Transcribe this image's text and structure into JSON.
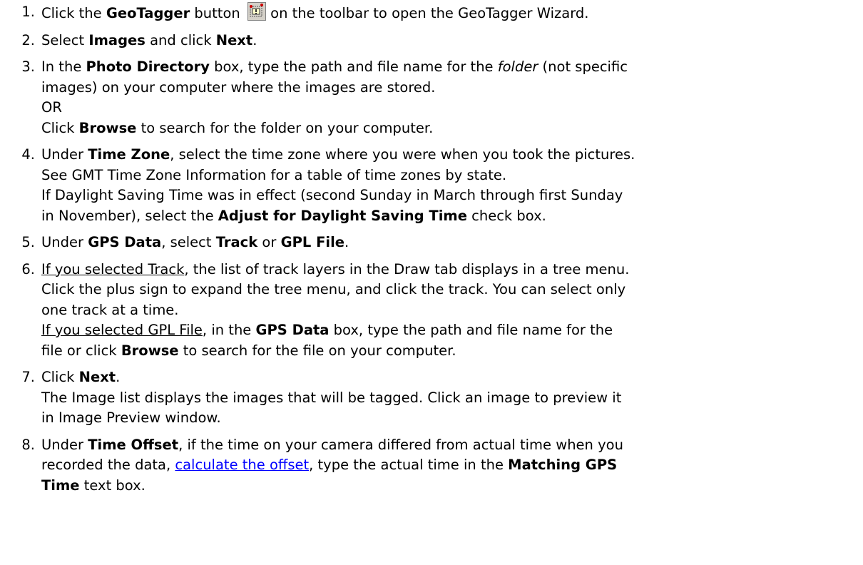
{
  "steps": [
    {
      "num": "1.",
      "parts": [
        "Click the ",
        "GeoTagger",
        " button ",
        " on the toolbar to open the GeoTagger Wizard."
      ],
      "icon": "geotagger-icon"
    },
    {
      "num": "2.",
      "parts": [
        "Select ",
        "Images",
        " and click ",
        "Next",
        "."
      ]
    },
    {
      "num": "3.",
      "lines": [
        [
          "In the ",
          "Photo Directory",
          " box, type the path and file name for the ",
          "folder",
          " (not specific"
        ],
        [
          "images) on your computer where the images are stored."
        ],
        [
          "OR"
        ],
        [
          "Click ",
          "Browse",
          " to search for the folder on your computer."
        ]
      ]
    },
    {
      "num": "4.",
      "lines": [
        [
          "Under ",
          "Time Zone",
          ", select the time zone where you were when you took the pictures."
        ],
        [
          "See GMT Time Zone Information for a table of time zones by state."
        ],
        [
          "If Daylight Saving Time was in effect (second Sunday in March through first Sunday"
        ],
        [
          "in November), select the ",
          "Adjust for Daylight Saving Time",
          " check box."
        ]
      ]
    },
    {
      "num": "5.",
      "parts": [
        "Under ",
        "GPS Data",
        ", select ",
        "Track",
        " or ",
        "GPL File",
        "."
      ]
    },
    {
      "num": "6.",
      "lines": [
        [
          "If you selected Track",
          ", the list of track layers in the Draw tab displays in a tree menu."
        ],
        [
          "Click the plus sign to expand the tree menu, and click the track. You can select only"
        ],
        [
          "one track at a time."
        ],
        [
          "If you selected GPL File",
          ", in the ",
          "GPS Data",
          " box, type the path and file name for the"
        ],
        [
          "file or click ",
          "Browse",
          " to search for the file on your computer."
        ]
      ]
    },
    {
      "num": "7.",
      "lines": [
        [
          "Click ",
          "Next",
          "."
        ],
        [
          "The Image list displays the images that will be tagged. Click an image to preview it"
        ],
        [
          "in Image Preview window."
        ]
      ]
    },
    {
      "num": "8.",
      "lines": [
        [
          "Under ",
          "Time Offset",
          ", if the time on your camera differed from actual time when you"
        ],
        [
          "recorded the data, ",
          "calculate the offset",
          ", type the actual time in the ",
          "Matching GPS"
        ],
        [
          "Time",
          " text box."
        ]
      ]
    }
  ]
}
